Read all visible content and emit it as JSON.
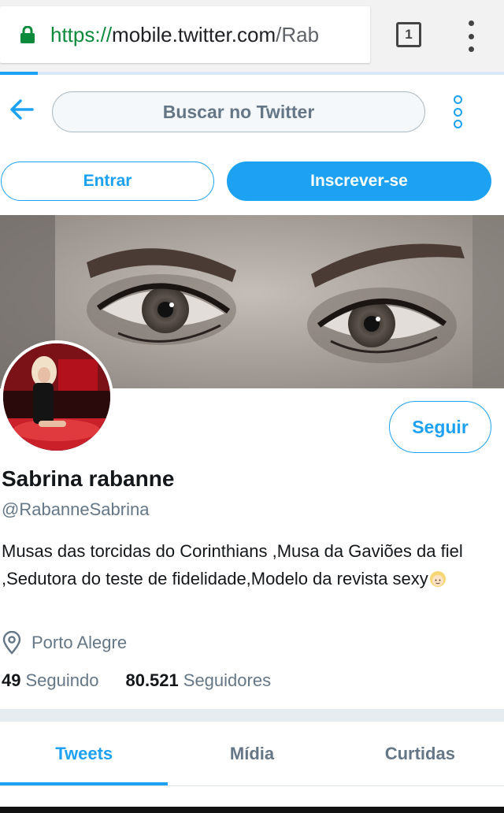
{
  "browser": {
    "url_scheme": "https://",
    "url_host": "mobile.twitter.com",
    "url_path": "/Rab",
    "tab_count": "1",
    "load_progress": 0.075,
    "icons": {
      "lock": "lock-icon",
      "menu": "vertical-dots-icon"
    }
  },
  "header": {
    "search_placeholder": "Buscar no Twitter",
    "login_label": "Entrar",
    "signup_label": "Inscrever-se",
    "icons": {
      "back": "arrow-left-icon",
      "more": "vertical-circles-icon"
    }
  },
  "profile": {
    "follow_label": "Seguir",
    "display_name": "Sabrina rabanne",
    "handle": "@RabanneSabrina",
    "bio": "Musas das torcidas do Corinthians ,Musa da Gaviões da fiel ,Sedutora do teste de fidelidade,Modelo da revista sexy",
    "bio_emoji": "blond-person-emoji",
    "location": "Porto Alegre",
    "following_count": "49",
    "following_label": "Seguindo",
    "followers_count": "80.521",
    "followers_label": "Seguidores"
  },
  "tabs": [
    {
      "label": "Tweets",
      "active": true
    },
    {
      "label": "Mídia",
      "active": false
    },
    {
      "label": "Curtidas",
      "active": false
    }
  ],
  "colors": {
    "accent": "#1da1f2",
    "text": "#14171a",
    "secondary_text": "#657786",
    "lock": "#0a8a3a"
  }
}
